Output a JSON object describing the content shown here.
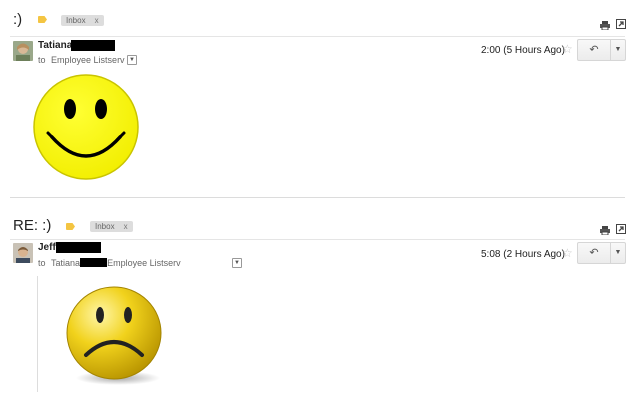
{
  "thread1": {
    "subject": ":)",
    "chip_label": "Inbox",
    "chip_close": "x",
    "sender_name": "Tatiana",
    "to_prefix": "to",
    "to_recipient": "Employee Listserv",
    "time": "2:00 (5 Hours Ago)"
  },
  "thread2": {
    "subject": "RE:  :)",
    "chip_label": "Inbox",
    "chip_close": "x",
    "sender_name": "Jeff",
    "to_prefix": "to",
    "to_recipient_1": "Tatiana",
    "to_recipient_2": "Employee Listserv",
    "time": "5:08 (2 Hours Ago)"
  },
  "icons": {
    "label": "label-tag-icon",
    "print": "print-icon",
    "new_window": "new-window-icon",
    "star": "star-icon",
    "reply": "reply-icon",
    "more": "chevron-down-icon",
    "show_details": "chevron-down-icon"
  },
  "colors": {
    "label_tag": "#f4c542",
    "chip_bg": "#dddddd",
    "smiley_yellow": "#ffff00",
    "sad_gold": "#e6c200"
  },
  "images": {
    "message1": "happy-smiley-face",
    "message2": "sad-face-button"
  }
}
